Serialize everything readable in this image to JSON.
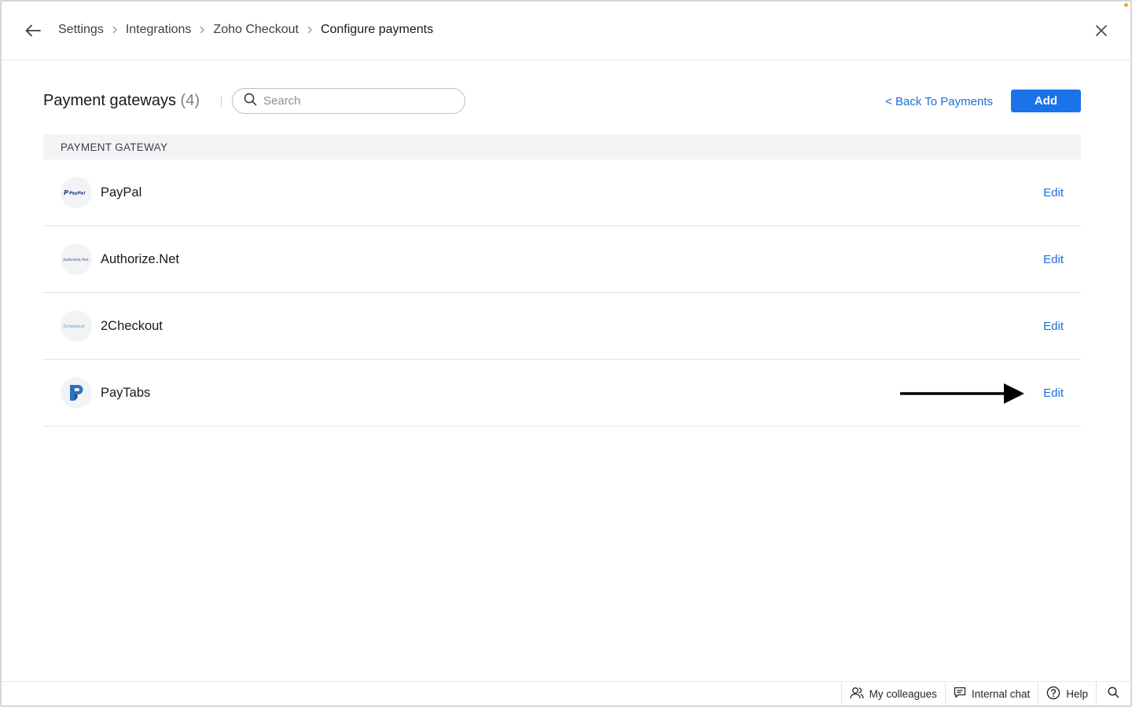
{
  "header": {
    "breadcrumb": [
      "Settings",
      "Integrations",
      "Zoho Checkout",
      "Configure payments"
    ]
  },
  "toolbar": {
    "title": "Payment gateways",
    "count": "(4)",
    "search_placeholder": "Search",
    "search_value": "",
    "back_link": "< Back To Payments",
    "add_label": "Add"
  },
  "table": {
    "column_header": "PAYMENT GATEWAY",
    "rows": [
      {
        "name": "PayPal",
        "logo_text": "PayPal",
        "action": "Edit"
      },
      {
        "name": "Authorize.Net",
        "logo_text": "Authorize.Net",
        "action": "Edit"
      },
      {
        "name": "2Checkout",
        "logo_text": "2checkout",
        "action": "Edit"
      },
      {
        "name": "PayTabs",
        "logo_text": "",
        "action": "Edit"
      }
    ]
  },
  "bottombar": {
    "colleagues": "My colleagues",
    "chat": "Internal chat",
    "help": "Help"
  },
  "colors": {
    "accent": "#1a73e8",
    "link": "#1a6fd6",
    "header_bg": "#f3f4f6"
  }
}
